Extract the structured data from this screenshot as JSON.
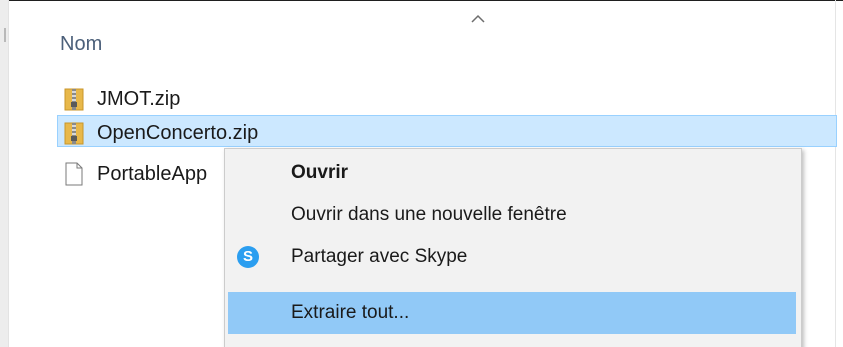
{
  "header": {
    "column_label": "Nom"
  },
  "files": [
    {
      "name": "JMOT.zip",
      "icon": "zip-folder-icon"
    },
    {
      "name": "OpenConcerto.zip",
      "icon": "zip-folder-icon",
      "selected": true
    },
    {
      "name": "PortableApp",
      "icon": "document-icon"
    }
  ],
  "context_menu": {
    "items": [
      {
        "label": "Ouvrir",
        "bold": true
      },
      {
        "label": "Ouvrir dans une nouvelle fenêtre"
      },
      {
        "label": "Partager avec Skype",
        "icon": "skype-icon"
      },
      {
        "label": "Extraire tout...",
        "highlighted": true
      }
    ],
    "skype_glyph": "S"
  },
  "colors": {
    "selection_bg": "#cce8ff",
    "selection_border": "#99d1ff",
    "menu_highlight": "#91c9f7",
    "menu_bg": "#f2f2f2",
    "header_text": "#4c607a",
    "skype_blue": "#2b9ef0"
  }
}
